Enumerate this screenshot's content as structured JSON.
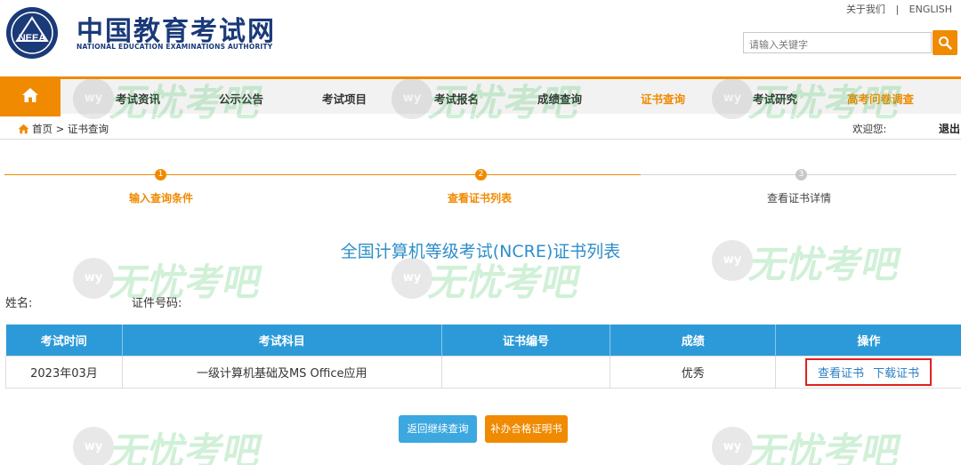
{
  "header": {
    "title": "中国教育考试网",
    "subtitle": "NATIONAL EDUCATION EXAMINATIONS AUTHORITY",
    "emblem_text": "NEEA",
    "top_links": [
      "关于我们",
      "|",
      "ENGLISH"
    ],
    "search_placeholder": "请输入关键字",
    "search_icon": "search-icon"
  },
  "nav": {
    "home_icon": "home-icon",
    "items": [
      "考试资讯",
      "公示公告",
      "考试项目",
      "考试报名",
      "成绩查询",
      "证书查询",
      "考试研究",
      "高考问卷调查"
    ],
    "active": "证书查询",
    "highlight_color": "#f08a00"
  },
  "breadcrumb": {
    "text": "首页 > 证书查询",
    "welcome": "欢迎您:",
    "logout": "退出"
  },
  "steps": [
    {
      "num": "1",
      "label": "输入查询条件",
      "status": "done"
    },
    {
      "num": "2",
      "label": "查看证书列表",
      "status": "current"
    },
    {
      "num": "3",
      "label": "查看证书详情",
      "status": "todo"
    }
  ],
  "page_title": "全国计算机等级考试(NCRE)证书列表",
  "info": {
    "name_label": "姓名:",
    "id_label": "证件号码:"
  },
  "table": {
    "headers": [
      "考试时间",
      "考试科目",
      "证书编号",
      "成绩",
      "操作"
    ],
    "rows": [
      {
        "time": "2023年03月",
        "subject": "一级计算机基础及MS Office应用",
        "cert_no": "",
        "score": "优秀",
        "ops": [
          "查看证书",
          "下载证书"
        ]
      }
    ]
  },
  "buttons": {
    "back": "返回继续查询",
    "apply": "补办合格证明书"
  },
  "watermark": {
    "badge": "wy",
    "text": "无忧考吧"
  },
  "colors": {
    "brand_orange": "#f08a00",
    "table_header_blue": "#2c9ad8",
    "title_blue": "#2e8ec9"
  }
}
